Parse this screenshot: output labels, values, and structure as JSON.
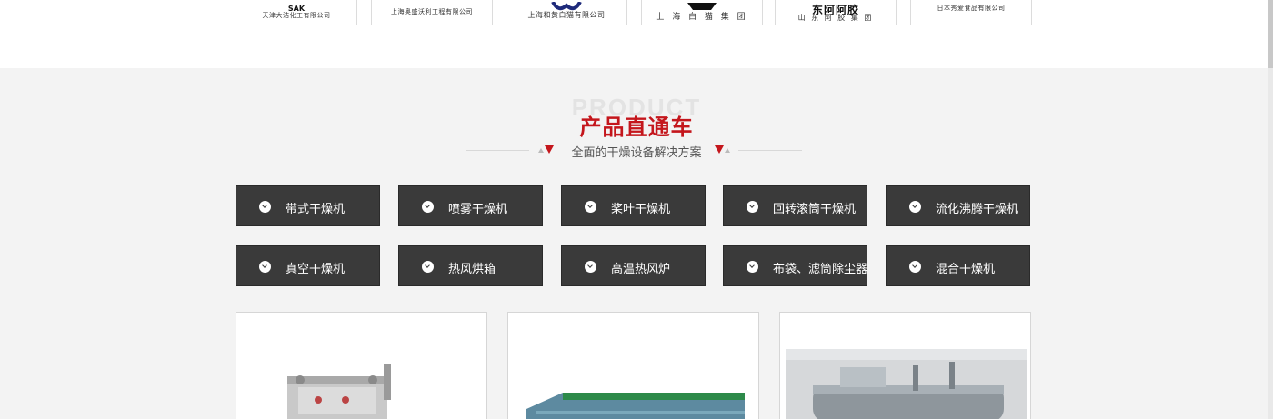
{
  "partners": [
    {
      "name": "天津大沽化工有限公司",
      "logo_text": "SAK"
    },
    {
      "name": "上海奥盛沃利工程有限公司",
      "logo_text": ""
    },
    {
      "name": "上海和黄白猫有限公司",
      "logo_text": ""
    },
    {
      "name": "上 海 白 猫 集 团",
      "logo_text": ""
    },
    {
      "name": "山 东 阿 胶 集 团",
      "logo_text": "东阿阿胶"
    },
    {
      "name": "日本秀爱食品有限公司",
      "logo_text": ""
    }
  ],
  "section": {
    "bg_word": "PRODUCT",
    "title": "产品直通车",
    "subtitle": "全面的干燥设备解决方案"
  },
  "categories": [
    {
      "label": "带式干燥机"
    },
    {
      "label": "喷雾干燥机"
    },
    {
      "label": "桨叶干燥机"
    },
    {
      "label": "回转滚筒干燥机"
    },
    {
      "label": "流化沸腾干燥机"
    },
    {
      "label": "真空干燥机"
    },
    {
      "label": "热风烘箱"
    },
    {
      "label": "高温热风炉"
    },
    {
      "label": "布袋、滤筒除尘器"
    },
    {
      "label": "混合干燥机"
    }
  ],
  "cards": [
    {
      "icon": "paddle-dryer-photo"
    },
    {
      "icon": "belt-dryer-photo"
    },
    {
      "icon": "drum-dryer-photo"
    }
  ],
  "colors": {
    "accent": "#c4161c",
    "button_bg": "#3a3a3a",
    "section_bg": "#f3f3f3"
  }
}
